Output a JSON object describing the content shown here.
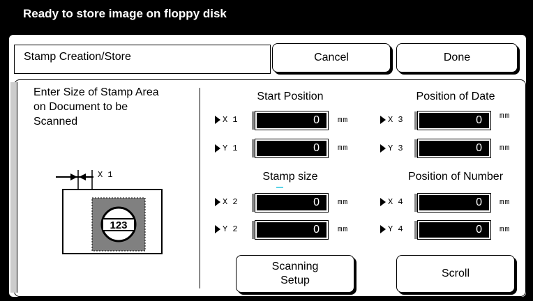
{
  "status": {
    "text": "Ready to store image on floppy disk"
  },
  "header": {
    "title": "Stamp Creation/Store",
    "cancel_label": "Cancel",
    "done_label": "Done"
  },
  "instruction": {
    "text": "Enter Size of Stamp Area on Document to be Scanned"
  },
  "diagram": {
    "dimension_label": "X 1",
    "stamp_text": "123"
  },
  "sections": {
    "start_position": "Start Position",
    "position_of_date": "Position of Date",
    "stamp_size": "Stamp size",
    "position_of_number": "Position of Number"
  },
  "fields": {
    "x1": {
      "label": "X 1",
      "value": "0",
      "unit": "mm"
    },
    "y1": {
      "label": "Y 1",
      "value": "0",
      "unit": "mm"
    },
    "x3": {
      "label": "X 3",
      "value": "0",
      "unit": "mm"
    },
    "y3": {
      "label": "Y 3",
      "value": "0",
      "unit": "mm"
    },
    "x2": {
      "label": "X 2",
      "value": "0",
      "unit": "mm"
    },
    "y2": {
      "label": "Y 2",
      "value": "0",
      "unit": "mm"
    },
    "x4": {
      "label": "X 4",
      "value": "0",
      "unit": "mm"
    },
    "y4": {
      "label": "Y 4",
      "value": "0",
      "unit": "mm"
    }
  },
  "footer": {
    "scanning_setup_label": "Scanning\nSetup",
    "scroll_label": "Scroll"
  },
  "colors": {
    "background": "#000000",
    "panel": "#ffffff",
    "stamp_area": "#808080",
    "accent_mark": "#5cd4e8"
  }
}
